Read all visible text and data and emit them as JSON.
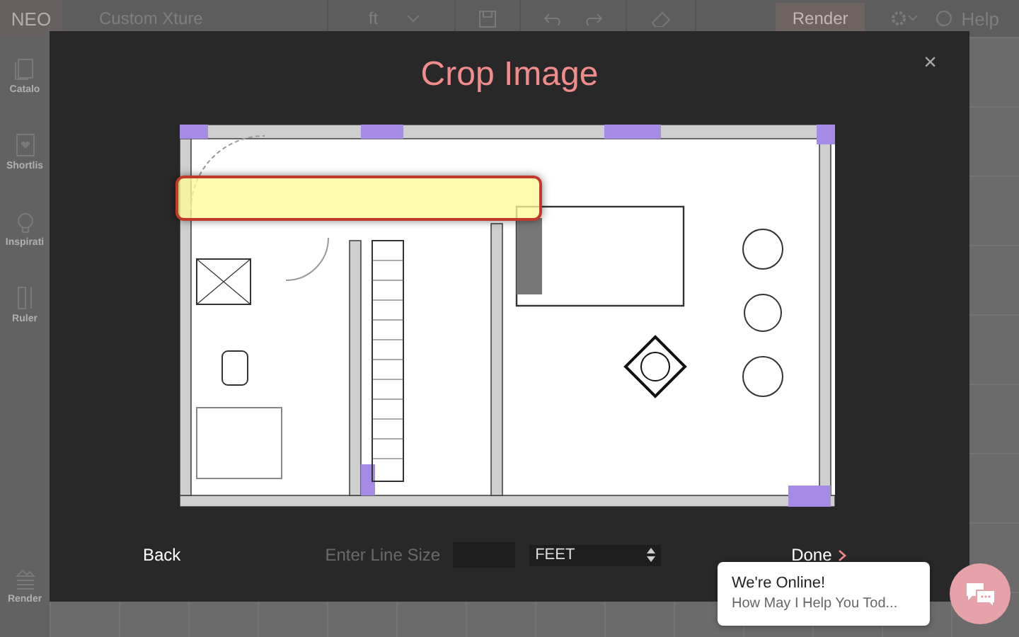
{
  "app": {
    "logo": "NEO",
    "project": "Custom Xture",
    "unit": "ft",
    "render_button": "Render",
    "help": "Help"
  },
  "sidebar": [
    {
      "kind": "catalog",
      "label": "Catalo"
    },
    {
      "kind": "shortlist",
      "label": "Shortlis"
    },
    {
      "kind": "inspiration",
      "label": "Inspirati"
    },
    {
      "kind": "ruler",
      "label": "Ruler"
    },
    {
      "kind": "render",
      "label": "Render"
    }
  ],
  "dialog": {
    "title": "Crop Image",
    "close": "×",
    "back": "Back",
    "line_size_label": "Enter Line Size",
    "unit_select": "FEET",
    "done": "Done"
  },
  "chat": {
    "title": "We're Online!",
    "message": "How May I Help You Tod..."
  }
}
